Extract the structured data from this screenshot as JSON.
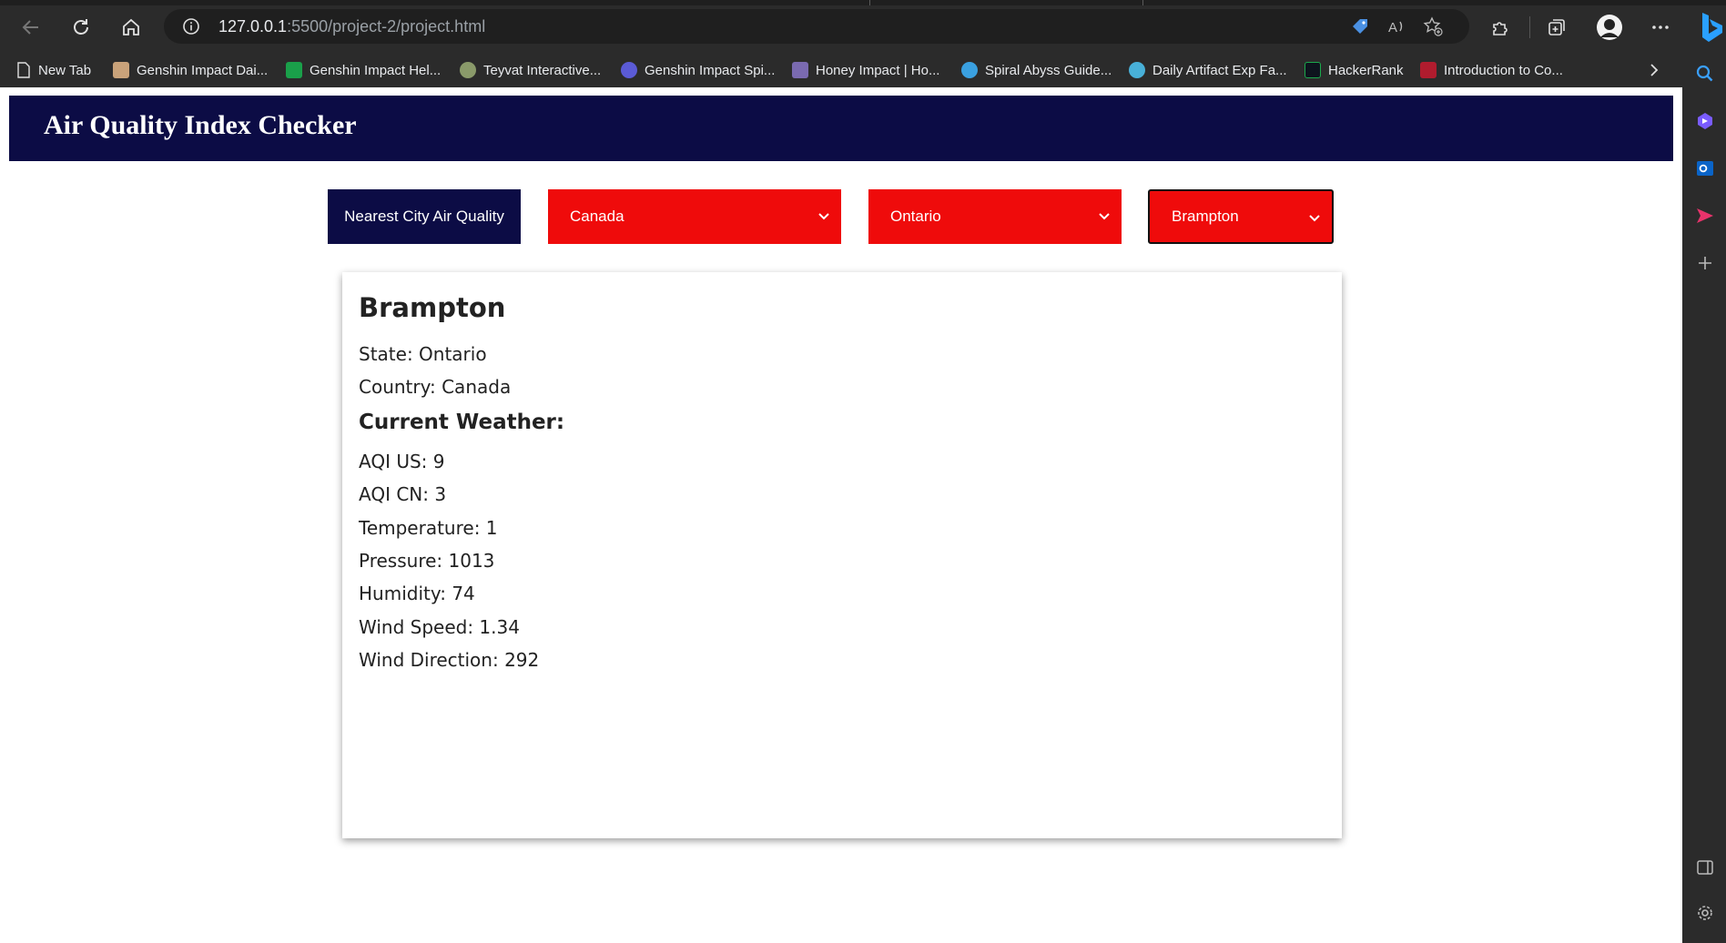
{
  "browser": {
    "url_host": "127.0.0.1",
    "url_rest": ":5500/project-2/project.html",
    "bookmarks": [
      {
        "label": "New Tab",
        "color": "#e8eaed"
      },
      {
        "label": "Genshin Impact Dai...",
        "color": "#c9a27a"
      },
      {
        "label": "Genshin Impact Hel...",
        "color": "#1aa04a"
      },
      {
        "label": "Teyvat Interactive...",
        "color": "#8a9a6a"
      },
      {
        "label": "Genshin Impact Spi...",
        "color": "#5b5bd6"
      },
      {
        "label": "Honey Impact | Ho...",
        "color": "#7a6ab0"
      },
      {
        "label": "Spiral Abyss Guide...",
        "color": "#3aa0e0"
      },
      {
        "label": "Daily Artifact Exp Fa...",
        "color": "#48b0d8"
      },
      {
        "label": "HackerRank",
        "color": "#1ba94c"
      },
      {
        "label": "Introduction to Co...",
        "color": "#b01c2e"
      }
    ]
  },
  "page": {
    "title": "Air Quality Index Checker",
    "nearest_button": "Nearest City Air Quality",
    "country_select": "Canada",
    "state_select": "Ontario",
    "city_select": "Brampton",
    "colors": {
      "header_bg": "#0c0c45",
      "select_bg": "#ef0b0b"
    }
  },
  "result": {
    "city": "Brampton",
    "state_line": "State: Ontario",
    "country_line": "Country: Canada",
    "weather_heading": "Current Weather:",
    "aqi_us": "AQI US: 9",
    "aqi_cn": "AQI CN: 3",
    "temperature": "Temperature: 1",
    "pressure": "Pressure: 1013",
    "humidity": "Humidity: 74",
    "wind_speed": "Wind Speed: 1.34",
    "wind_direction": "Wind Direction: 292"
  }
}
